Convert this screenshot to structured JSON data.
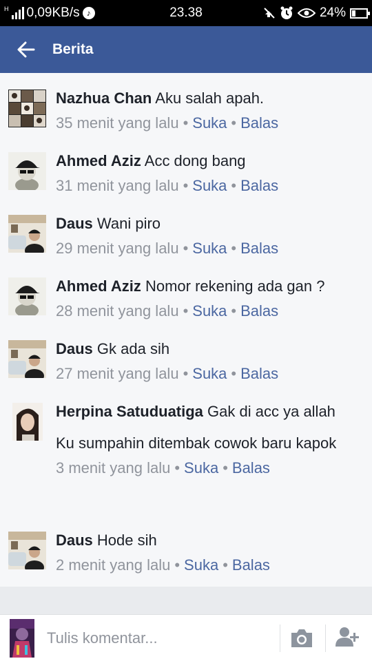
{
  "status_bar": {
    "network_type": "H",
    "speed": "0,09KB/s",
    "time": "23.38",
    "battery": "24%",
    "battery_level": 0.24
  },
  "header": {
    "title": "Berita"
  },
  "comments": [
    {
      "author": "Nazhua Chan",
      "text": "Aku salah apah.",
      "extra": "",
      "time": "35 menit yang lalu",
      "like": "Suka",
      "reply": "Balas"
    },
    {
      "author": "Ahmed Aziz",
      "text": "Acc dong bang",
      "extra": "",
      "time": "31 menit yang lalu",
      "like": "Suka",
      "reply": "Balas"
    },
    {
      "author": "Daus",
      "text": "Wani piro",
      "extra": "",
      "time": "29 menit yang lalu",
      "like": "Suka",
      "reply": "Balas"
    },
    {
      "author": "Ahmed Aziz",
      "text": "Nomor rekening ada gan ?",
      "extra": "",
      "time": "28 menit yang lalu",
      "like": "Suka",
      "reply": "Balas"
    },
    {
      "author": "Daus",
      "text": "Gk ada sih",
      "extra": "",
      "time": "27 menit yang lalu",
      "like": "Suka",
      "reply": "Balas"
    },
    {
      "author": "Herpina Satuduatiga",
      "text": "Gak di acc ya allah",
      "extra": "Ku sumpahin ditembak cowok baru kapok",
      "time": "3 menit yang lalu",
      "like": "Suka",
      "reply": "Balas"
    },
    {
      "author": "Daus",
      "text": "Hode sih",
      "extra": "",
      "time": "2 menit yang lalu",
      "like": "Suka",
      "reply": "Balas"
    }
  ],
  "composer": {
    "placeholder": "Tulis komentar..."
  },
  "colors": {
    "header_bg": "#3b5998",
    "link": "#4b67a1",
    "meta": "#90949c"
  }
}
